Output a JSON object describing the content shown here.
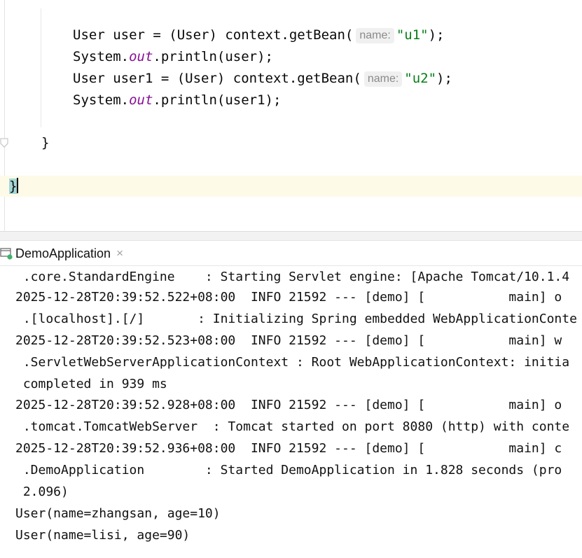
{
  "editor": {
    "lines": [
      {
        "pre": "User user = (User) context.getBean(",
        "hint": "name:",
        "str": "\"u1\"",
        "post": ");"
      },
      {
        "pre": "System.",
        "fld": "out",
        "post": ".println(user);"
      },
      {
        "pre": "User user1 = (User) context.getBean(",
        "hint": "name:",
        "str": "\"u2\"",
        "post": ");"
      },
      {
        "pre": "System.",
        "fld": "out",
        "post": ".println(user1);"
      }
    ],
    "close_inner": "}",
    "close_outer": "}"
  },
  "run_tab": {
    "label": "DemoApplication",
    "close": "×",
    "icon": "spring-run-icon"
  },
  "console": {
    "lines": [
      " .core.StandardEngine    : Starting Servlet engine: [Apache Tomcat/10.1.4",
      "2025-12-28T20:39:52.522+08:00  INFO 21592 --- [demo] [           main] o",
      " .[localhost].[/]       : Initializing Spring embedded WebApplicationConte",
      "2025-12-28T20:39:52.523+08:00  INFO 21592 --- [demo] [           main] w",
      " .ServletWebServerApplicationContext : Root WebApplicationContext: initia",
      " completed in 939 ms",
      "2025-12-28T20:39:52.928+08:00  INFO 21592 --- [demo] [           main] o",
      " .tomcat.TomcatWebServer  : Tomcat started on port 8080 (http) with conte",
      "2025-12-28T20:39:52.936+08:00  INFO 21592 --- [demo] [           main] c",
      " .DemoApplication        : Started DemoApplication in 1.828 seconds (pro",
      " 2.096)",
      "User(name=zhangsan, age=10)",
      "User(name=lisi, age=90)"
    ]
  },
  "colors": {
    "string": "#067d17",
    "field": "#871094",
    "brace_highlight": "#a6d6d6",
    "caret_line": "#fdfbe8"
  }
}
